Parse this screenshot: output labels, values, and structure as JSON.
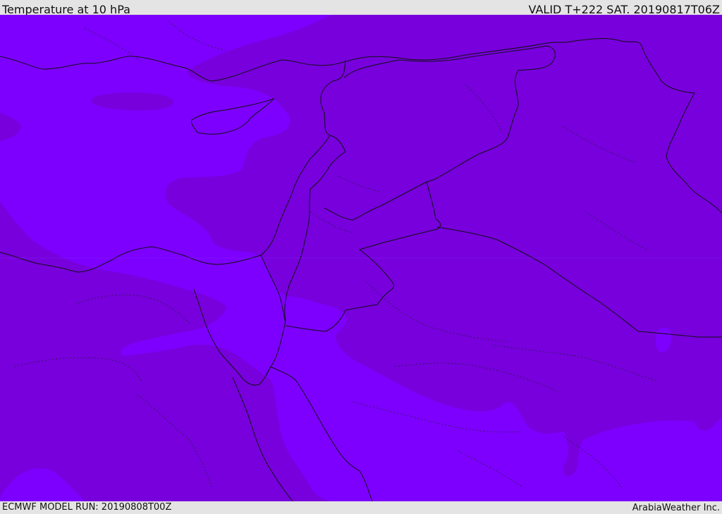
{
  "header": {
    "title": "Temperature at 10 hPa",
    "valid_time": "VALID T+222 SAT. 20190817T06Z"
  },
  "footer": {
    "model_run": "ECMWF MODEL RUN: 20190808T00Z",
    "credit": "ArabiaWeather Inc."
  },
  "map": {
    "field": "temperature",
    "level": "10 hPa",
    "colors": {
      "warmer_band": "#7d00ff",
      "cooler_band": "#7700dd",
      "borders": "#111111",
      "frame": "#e4e4e4"
    }
  }
}
